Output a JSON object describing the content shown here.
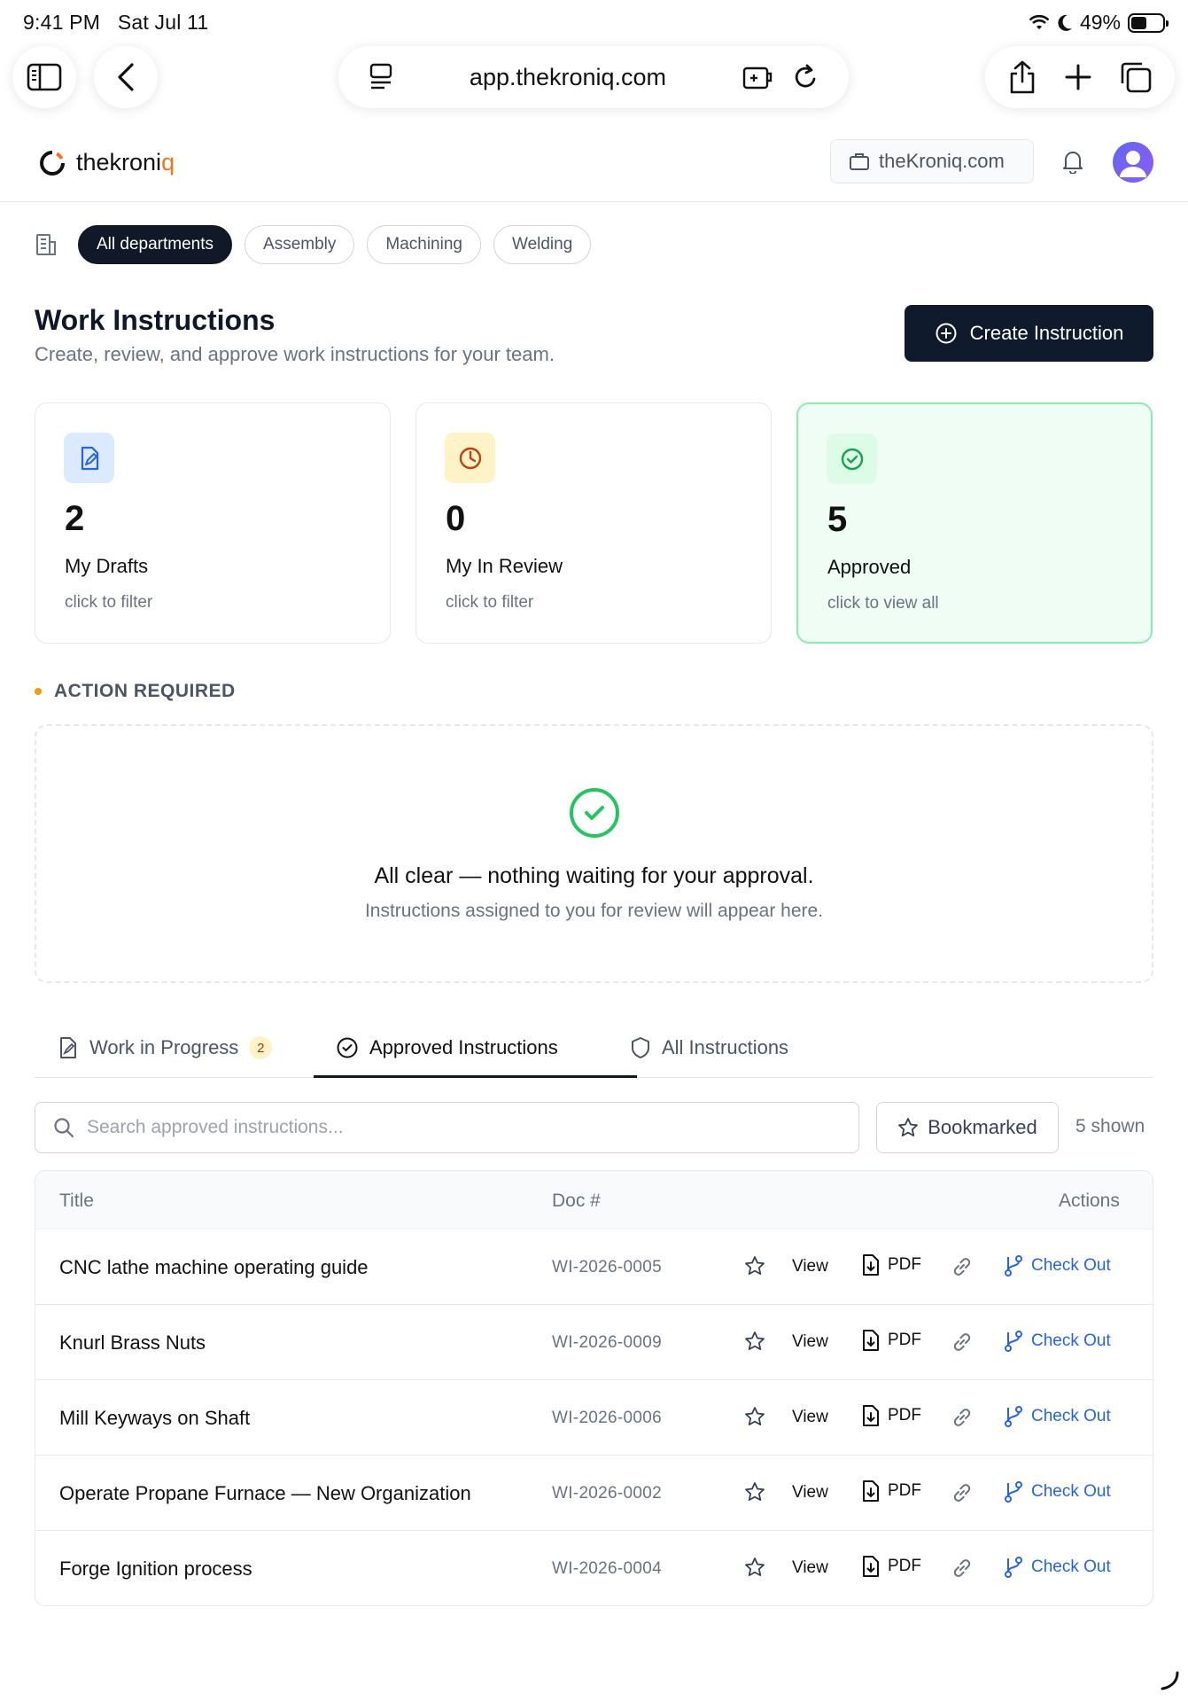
{
  "status_bar": {
    "time": "9:41 PM",
    "date": "Sat Jul 11",
    "battery": "49%"
  },
  "browser": {
    "url": "app.thekroniq.com"
  },
  "header": {
    "logo_text": "thekroni",
    "logo_accent": "q",
    "domain_button": "theKroniq.com"
  },
  "departments": {
    "chips": [
      "All departments",
      "Assembly",
      "Machining",
      "Welding"
    ],
    "active": "All departments"
  },
  "page": {
    "title": "Work Instructions",
    "subtitle": "Create, review, and approve work instructions for your team.",
    "create_button": "Create Instruction"
  },
  "stats": [
    {
      "value": "2",
      "label": "My Drafts",
      "hint": "click to filter",
      "icon": "file-edit-icon",
      "color": "#2563eb"
    },
    {
      "value": "0",
      "label": "My In Review",
      "hint": "click to filter",
      "icon": "clock-icon",
      "color": "#c2410c"
    },
    {
      "value": "5",
      "label": "Approved",
      "hint": "click to view all",
      "icon": "check-circle-icon",
      "color": "#16a34a"
    }
  ],
  "action_required": {
    "label": "ACTION REQUIRED",
    "empty_title": "All clear — nothing waiting for your approval.",
    "empty_subtitle": "Instructions assigned to you for review will appear here."
  },
  "tabs": [
    {
      "label": "Work in Progress",
      "badge": "2",
      "icon": "file-edit-icon"
    },
    {
      "label": "Approved Instructions",
      "icon": "check-circle-icon",
      "active": true
    },
    {
      "label": "All Instructions",
      "icon": "shield-icon"
    }
  ],
  "search": {
    "placeholder": "Search approved instructions...",
    "value": ""
  },
  "bookmarked_button": "Bookmarked",
  "shown_count": "5 shown",
  "table": {
    "headers": {
      "title": "Title",
      "doc": "Doc #",
      "actions": "Actions"
    },
    "actions": {
      "view": "View",
      "pdf": "PDF",
      "checkout": "Check Out"
    },
    "rows": [
      {
        "title": "CNC lathe machine operating guide",
        "doc": "WI-2026-0005"
      },
      {
        "title": "Knurl Brass Nuts",
        "doc": "WI-2026-0009"
      },
      {
        "title": "Mill Keyways on Shaft",
        "doc": "WI-2026-0006"
      },
      {
        "title": "Operate Propane Furnace — New Organization",
        "doc": "WI-2026-0002"
      },
      {
        "title": "Forge Ignition process",
        "doc": "WI-2026-0004"
      }
    ]
  }
}
